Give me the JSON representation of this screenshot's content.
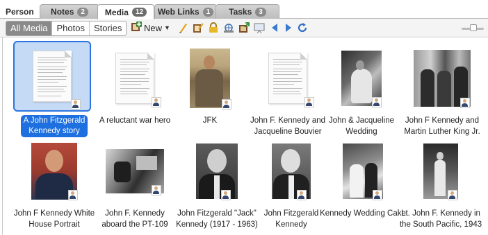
{
  "tabs": {
    "person": "Person",
    "notes": {
      "label": "Notes",
      "count": "2"
    },
    "media": {
      "label": "Media",
      "count": "12"
    },
    "weblinks": {
      "label": "Web Links",
      "count": "1"
    },
    "tasks": {
      "label": "Tasks",
      "count": "3"
    }
  },
  "filters": [
    "All Media",
    "Photos",
    "Stories"
  ],
  "active_filter": "All Media",
  "toolbar": {
    "new_label": "New",
    "icons": [
      "add-media-icon",
      "edit-pencil-icon",
      "properties-icon",
      "lock-icon",
      "link-icon",
      "export-icon",
      "slideshow-icon",
      "previous-icon",
      "next-icon",
      "refresh-icon"
    ]
  },
  "media_items": [
    {
      "caption_lines": [
        "A John Fitzgerald",
        "Kennedy story"
      ],
      "kind": "document",
      "selected": true
    },
    {
      "caption_lines": [
        "A reluctant war hero"
      ],
      "kind": "document"
    },
    {
      "caption_lines": [
        "JFK"
      ],
      "kind": "photo-color"
    },
    {
      "caption_lines": [
        "John F. Kennedy and",
        "Jacqueline Bouvier"
      ],
      "kind": "document"
    },
    {
      "caption_lines": [
        "John & Jacqueline",
        "Wedding"
      ],
      "kind": "photo-bw"
    },
    {
      "caption_lines": [
        "John F Kennedy and",
        "Martin Luther King Jr."
      ],
      "kind": "photo-bw"
    },
    {
      "caption_lines": [
        "John F Kennedy White",
        "House Portrait"
      ],
      "kind": "photo-color"
    },
    {
      "caption_lines": [
        "John F. Kennedy",
        "aboard the PT-109"
      ],
      "kind": "photo-bw"
    },
    {
      "caption_lines": [
        "John Fitzgerald \"Jack\"",
        "Kennedy (1917 - 1963)"
      ],
      "kind": "photo-bw"
    },
    {
      "caption_lines": [
        "John Fitzgerald",
        "Kennedy"
      ],
      "kind": "photo-bw"
    },
    {
      "caption_lines": [
        "Kennedy Wedding Cake"
      ],
      "kind": "photo-bw"
    },
    {
      "caption_lines": [
        "Lt. John F. Kennedy in",
        "the South Pacific, 1943"
      ],
      "kind": "photo-bw"
    }
  ],
  "colors": {
    "selection_fill": "#c4daf5",
    "selection_border": "#2b74e0",
    "caption_highlight": "#1e6fe0"
  }
}
